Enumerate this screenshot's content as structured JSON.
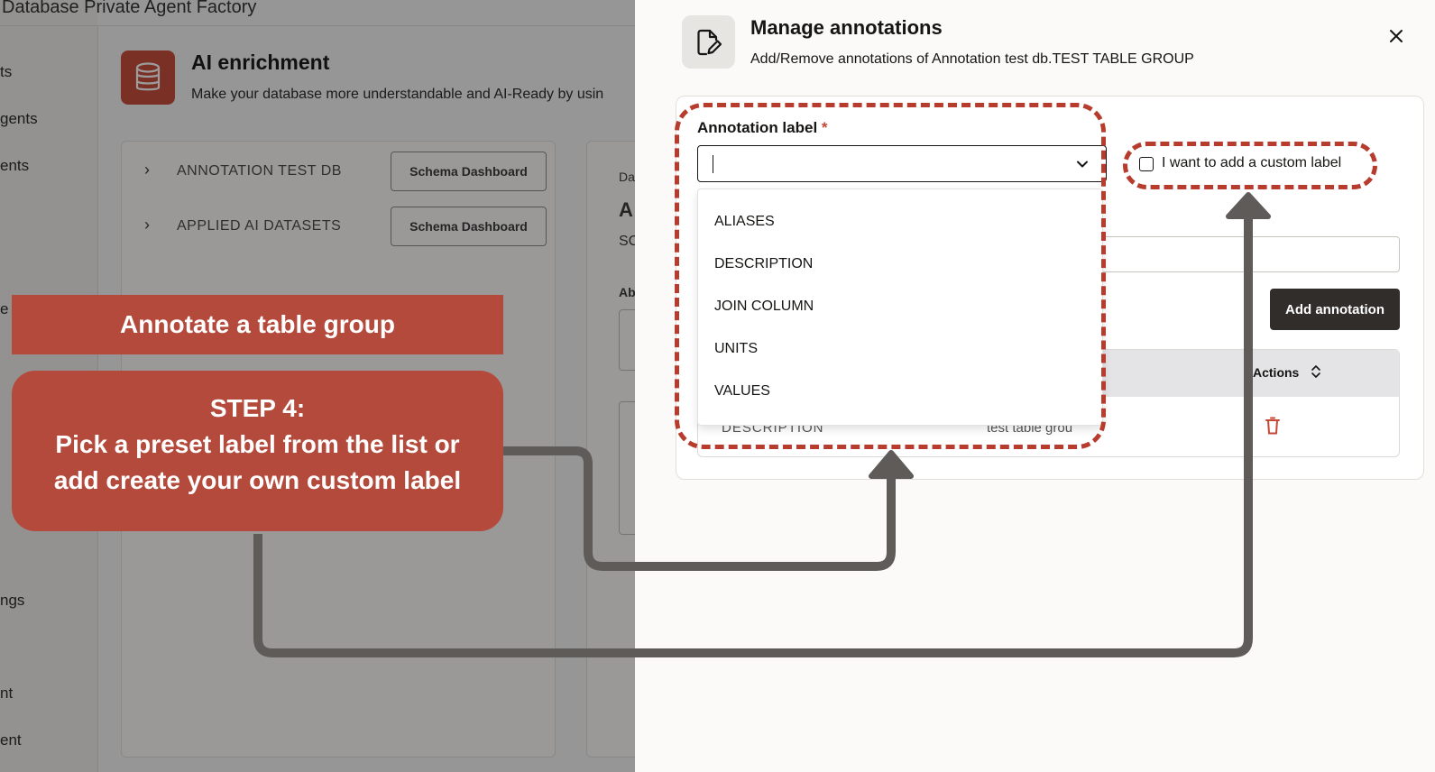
{
  "background": {
    "app_title": "Database Private Agent Factory",
    "nav_fragments": [
      "ts",
      "gents",
      "ents",
      "e",
      "ngs",
      "nt",
      "ent"
    ],
    "section_title": "AI enrichment",
    "section_subtitle": "Make your database more understandable and AI-Ready by usin",
    "rows": [
      {
        "label": "ANNOTATION TEST DB",
        "button": "Schema Dashboard"
      },
      {
        "label": "APPLIED AI DATASETS",
        "button": "Schema Dashboard"
      }
    ],
    "side_card_fragments": [
      "Da",
      "A",
      "SC",
      "Ab"
    ]
  },
  "modal": {
    "title": "Manage annotations",
    "subtitle": "Add/Remove annotations of Annotation test db.TEST TABLE GROUP",
    "label_field": {
      "label": "Annotation label",
      "required_mark": "*",
      "value": ""
    },
    "custom_label_checkbox": "I want to add a custom label",
    "options": [
      "ALIASES",
      "DESCRIPTION",
      "JOIN COLUMN",
      "UNITS",
      "VALUES"
    ],
    "add_button": "Add annotation",
    "table": {
      "actions_header": "Actions",
      "rows": [
        {
          "label": "DESCRIPTION",
          "value": "test table grou"
        }
      ]
    }
  },
  "tutorial": {
    "banner": "Annotate a table group",
    "step_title": "STEP 4:",
    "step_line1": "Pick a preset label from the list or",
    "step_line2": "add create your own custom label"
  },
  "colors": {
    "accent_red": "#c74634",
    "tutorial_red": "#b44a3b",
    "dashed_red": "#b83c2e",
    "button_dark": "#312d2a",
    "arrow_gray": "#5e5b58"
  }
}
